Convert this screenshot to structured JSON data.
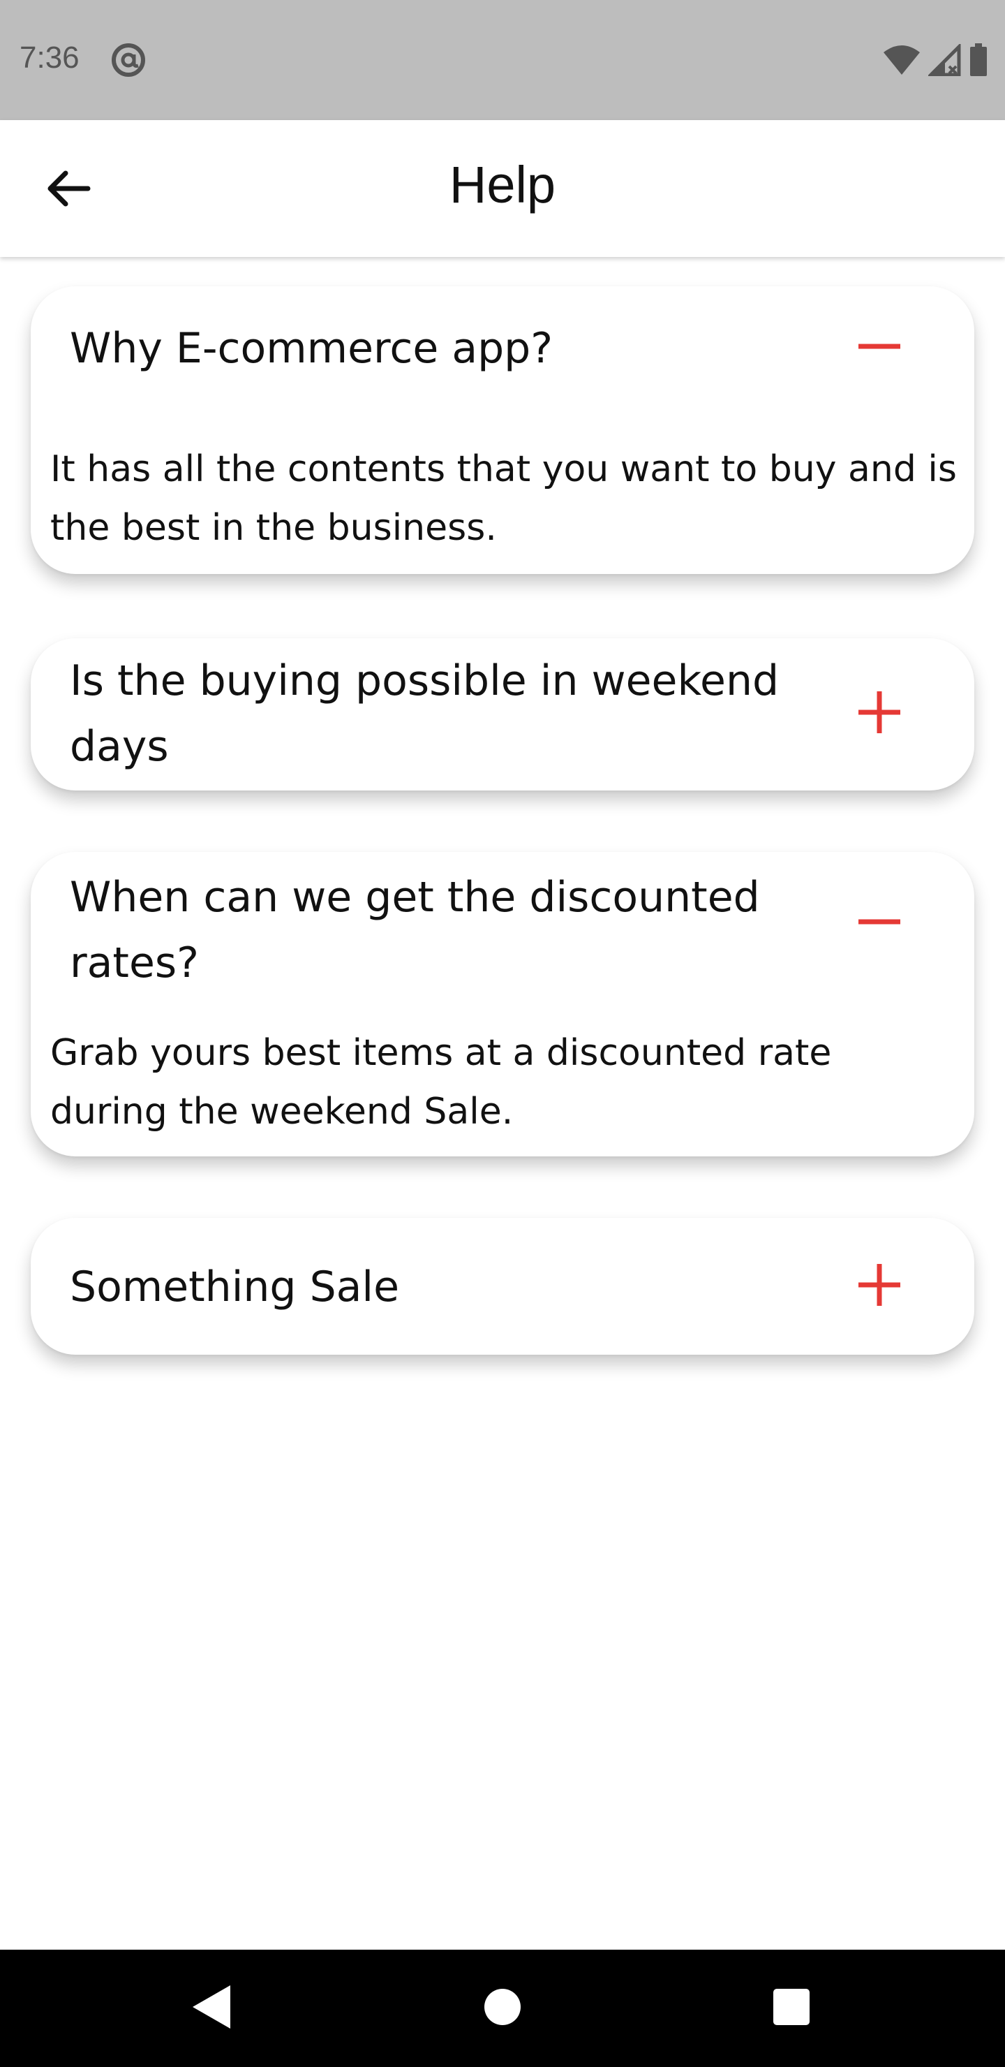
{
  "status_bar": {
    "time": "7:36",
    "icons": [
      "at-sign-icon",
      "wifi-icon",
      "signal-icon",
      "battery-icon"
    ]
  },
  "app_bar": {
    "title": "Help",
    "back_icon": "arrow-left-icon"
  },
  "colors": {
    "accent": "#e53935",
    "status_bar": "#bdbdbd",
    "nav_bar": "#000000"
  },
  "faqs": [
    {
      "question": "Why E-commerce app?",
      "answer": "It has all the contents that you want to buy and is the best in the business.",
      "expanded": true,
      "toggle_icon": "minus-icon"
    },
    {
      "question": "Is the buying possible in weekend days",
      "answer": "",
      "expanded": false,
      "toggle_icon": "plus-icon"
    },
    {
      "question": "When can we get the discounted rates?",
      "answer": "Grab yours best items at a discounted rate during the weekend Sale.",
      "expanded": true,
      "toggle_icon": "minus-icon"
    },
    {
      "question": "Something Sale",
      "answer": "",
      "expanded": false,
      "toggle_icon": "plus-icon"
    }
  ],
  "nav_bar": {
    "icons": [
      "back-triangle-icon",
      "home-circle-icon",
      "recents-square-icon"
    ]
  }
}
